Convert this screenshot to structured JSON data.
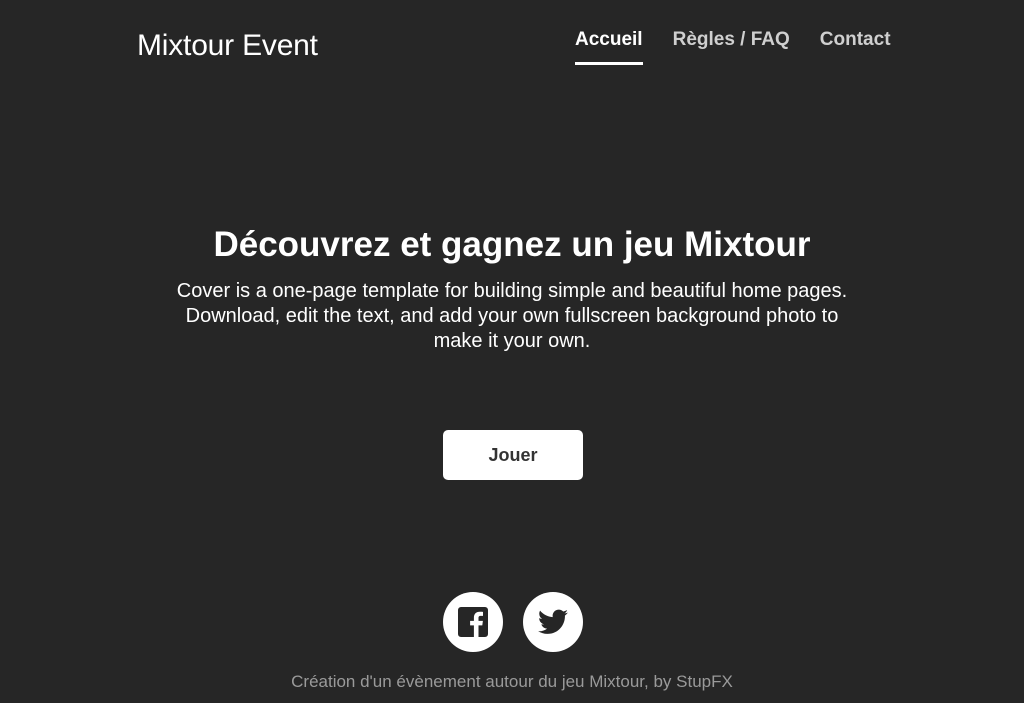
{
  "brand": "Mixtour Event",
  "nav": {
    "items": [
      {
        "label": "Accueil",
        "active": true
      },
      {
        "label": "Règles / FAQ",
        "active": false
      },
      {
        "label": "Contact",
        "active": false
      }
    ]
  },
  "cover": {
    "heading": "Découvrez et gagnez un jeu Mixtour",
    "lead": "Cover is a one-page template for building simple and beautiful home pages. Download, edit the text, and add your own fullscreen background photo to make it your own.",
    "button_label": "Jouer"
  },
  "social": [
    {
      "icon": "facebook-icon"
    },
    {
      "icon": "twitter-icon"
    }
  ],
  "footer": {
    "text": "Création d'un évènement autour du jeu Mixtour, by StupFX"
  },
  "colors": {
    "background": "#262626",
    "text": "#ffffff",
    "nav_inactive": "#cfcfcf",
    "footer_text": "#9a9a9a",
    "button_bg": "#ffffff",
    "button_text": "#333333"
  }
}
